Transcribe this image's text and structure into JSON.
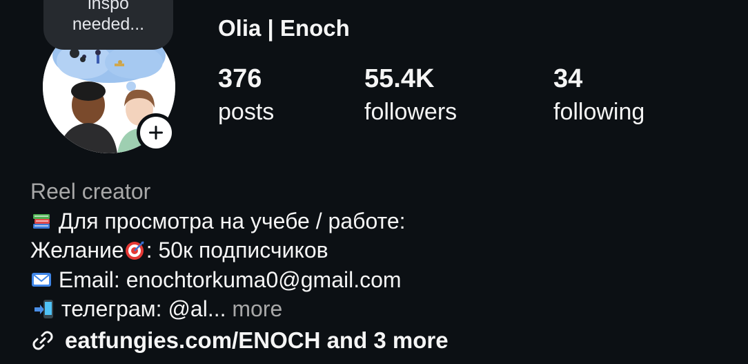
{
  "profile": {
    "display_name": "Olia | Enoch",
    "note": "inspo\nneeded...",
    "avatar_icon": "illustrated-couple-avatar",
    "add_story_icon": "plus-icon"
  },
  "stats": [
    {
      "value": "376",
      "label": "posts"
    },
    {
      "value": "55.4K",
      "label": "followers"
    },
    {
      "value": "34",
      "label": "following"
    }
  ],
  "bio": {
    "category": "Reel creator",
    "line1": "Для просмотра на учебе / работе:",
    "line1_emoji": "books-emoji",
    "line2a": "Желание",
    "line2_emoji": "target-emoji",
    "line2b": ": 50к подписчиков",
    "line3": "Email: enochtorkuma0@gmail.com",
    "line3_emoji": "envelope-emoji",
    "line4": "телеграм: @al...",
    "line4_emoji": "mobile-arrow-emoji",
    "more_label": "more"
  },
  "links": {
    "text": "eatfungies.com/ENOCH and 3 more",
    "icon": "link-icon"
  },
  "colors": {
    "background": "#0c1014",
    "text": "#f5f5f5",
    "secondary_text": "#a8a8a8",
    "note_bubble": "#262a2f"
  }
}
